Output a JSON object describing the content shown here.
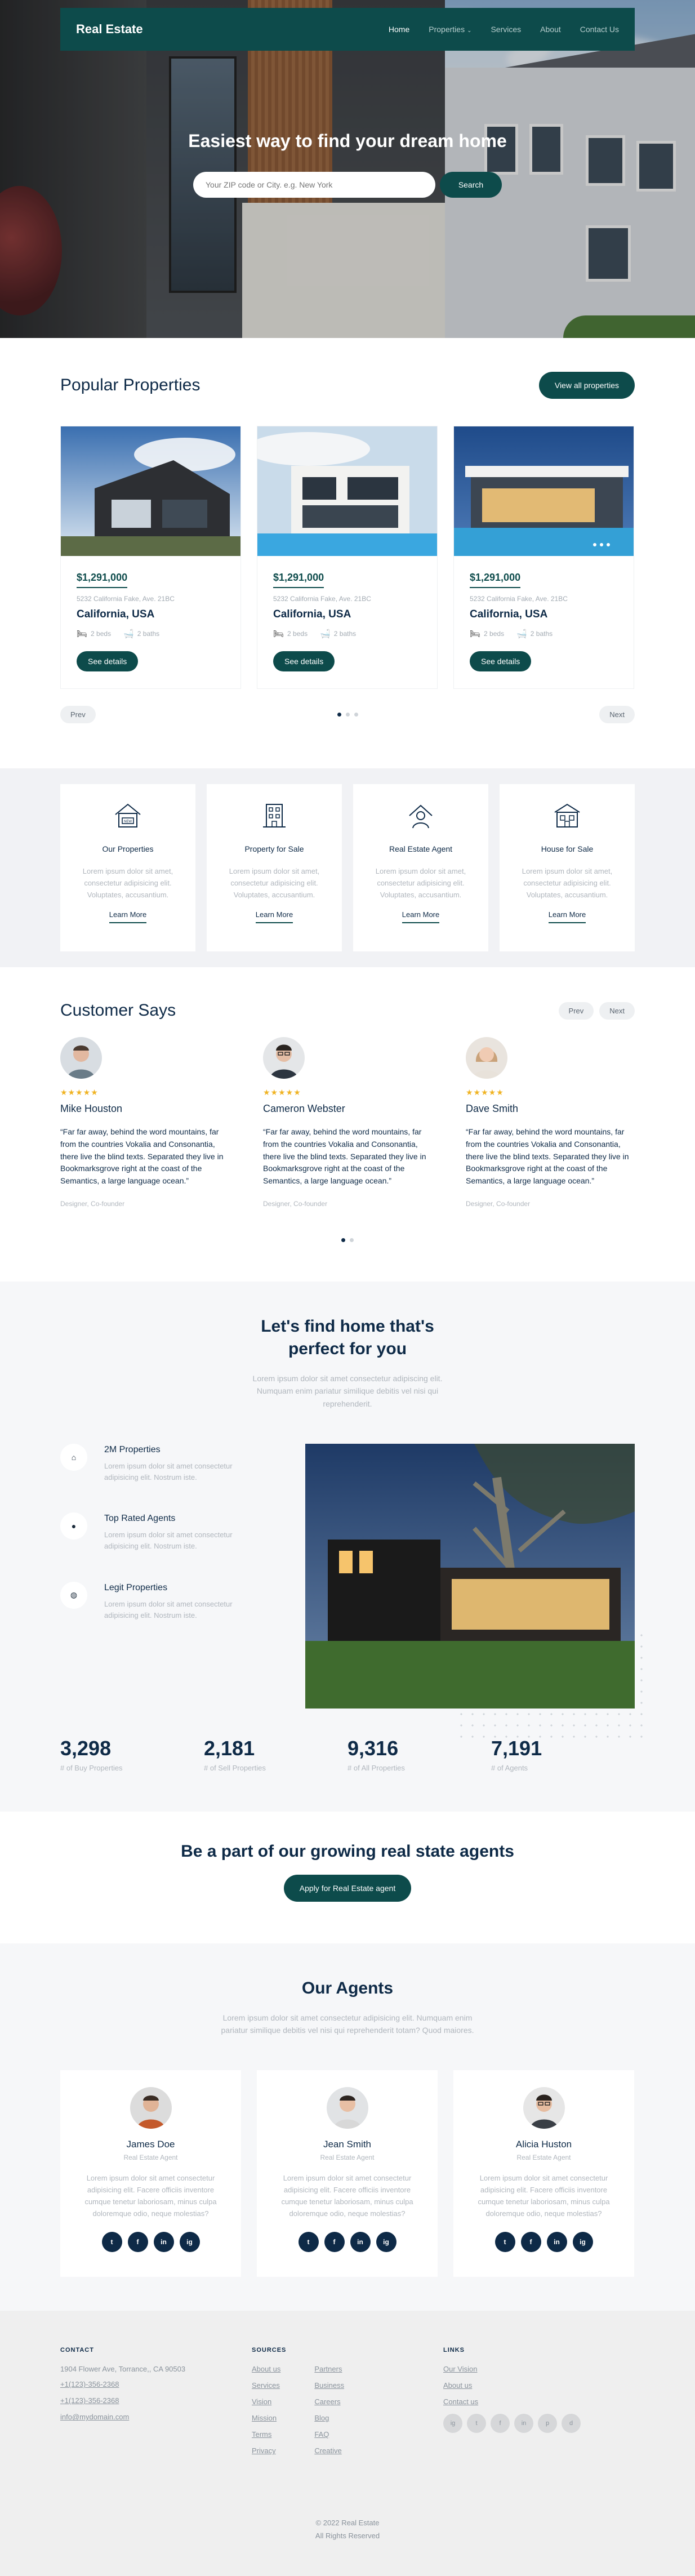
{
  "nav": {
    "brand": "Real Estate",
    "links": [
      "Home",
      "Properties",
      "Services",
      "About",
      "Contact Us"
    ]
  },
  "hero": {
    "title": "Easiest way to find your dream home",
    "search_placeholder": "Your ZIP code or City. e.g. New York",
    "search_button": "Search"
  },
  "popular": {
    "title": "Popular Properties",
    "view_all": "View all properties",
    "cards": [
      {
        "price": "$1,291,000",
        "address": "5232 California Fake, Ave. 21BC",
        "city": "California, USA",
        "beds": "2 beds",
        "baths": "2 baths",
        "button": "See details"
      },
      {
        "price": "$1,291,000",
        "address": "5232 California Fake, Ave. 21BC",
        "city": "California, USA",
        "beds": "2 beds",
        "baths": "2 baths",
        "button": "See details"
      },
      {
        "price": "$1,291,000",
        "address": "5232 California Fake, Ave. 21BC",
        "city": "California, USA",
        "beds": "2 beds",
        "baths": "2 baths",
        "button": "See details"
      }
    ],
    "prev": "Prev",
    "next": "Next"
  },
  "features": [
    {
      "title": "Our Properties",
      "text": "Lorem ipsum dolor sit amet, consectetur adipisicing elit. Voluptates, accusantium.",
      "link": "Learn More",
      "icon": "house-icon"
    },
    {
      "title": "Property for Sale",
      "text": "Lorem ipsum dolor sit amet, consectetur adipisicing elit. Voluptates, accusantium.",
      "link": "Learn More",
      "icon": "building-icon"
    },
    {
      "title": "Real Estate Agent",
      "text": "Lorem ipsum dolor sit amet, consectetur adipisicing elit. Voluptates, accusantium.",
      "link": "Learn More",
      "icon": "agent-icon"
    },
    {
      "title": "House for Sale",
      "text": "Lorem ipsum dolor sit amet, consectetur adipisicing elit. Voluptates, accusantium.",
      "link": "Learn More",
      "icon": "house-sale-icon"
    }
  ],
  "testimonials": {
    "title": "Customer Says",
    "prev": "Prev",
    "next": "Next",
    "stars": "★★★★★",
    "items": [
      {
        "name": "Mike Houston",
        "quote": "“Far far away, behind the word mountains, far from the countries Vokalia and Consonantia, there live the blind texts. Separated they live in Bookmarksgrove right at the coast of the Semantics, a large language ocean.”",
        "role": "Designer, Co-founder"
      },
      {
        "name": "Cameron Webster",
        "quote": "“Far far away, behind the word mountains, far from the countries Vokalia and Consonantia, there live the blind texts. Separated they live in Bookmarksgrove right at the coast of the Semantics, a large language ocean.”",
        "role": "Designer, Co-founder"
      },
      {
        "name": "Dave Smith",
        "quote": "“Far far away, behind the word mountains, far from the countries Vokalia and Consonantia, there live the blind texts. Separated they live in Bookmarksgrove right at the coast of the Semantics, a large language ocean.”",
        "role": "Designer, Co-founder"
      }
    ]
  },
  "why": {
    "title_line1": "Let's find home that's",
    "title_line2": "perfect for you",
    "subtitle": "Lorem ipsum dolor sit amet consectetur adipiscing elit. Numquam enim pariatur similique debitis vel nisi qui reprehenderit.",
    "items": [
      {
        "title": "2M Properties",
        "text": "Lorem ipsum dolor sit amet consectetur adipisicing elit. Nostrum iste.",
        "icon": "home-icon"
      },
      {
        "title": "Top Rated Agents",
        "text": "Lorem ipsum dolor sit amet consectetur adipisicing elit. Nostrum iste.",
        "icon": "person-icon"
      },
      {
        "title": "Legit Properties",
        "text": "Lorem ipsum dolor sit amet consectetur adipisicing elit. Nostrum iste.",
        "icon": "shield-icon"
      }
    ],
    "stats": [
      {
        "num": "3,298",
        "label": "# of Buy Properties"
      },
      {
        "num": "2,181",
        "label": "# of Sell Properties"
      },
      {
        "num": "9,316",
        "label": "# of All Properties"
      },
      {
        "num": "7,191",
        "label": "# of Agents"
      }
    ]
  },
  "cta": {
    "title": "Be a part of our growing real state agents",
    "button": "Apply for Real Estate agent"
  },
  "agents": {
    "title": "Our Agents",
    "subtitle": "Lorem ipsum dolor sit amet consectetur adipisicing elit. Numquam enim pariatur similique debitis vel nisi qui reprehenderit totam? Quod maiores.",
    "items": [
      {
        "name": "James Doe",
        "role": "Real Estate Agent",
        "text": "Lorem ipsum dolor sit amet consectetur adipisicing elit. Facere officiis inventore cumque tenetur laboriosam, minus culpa doloremque odio, neque molestias?"
      },
      {
        "name": "Jean Smith",
        "role": "Real Estate Agent",
        "text": "Lorem ipsum dolor sit amet consectetur adipisicing elit. Facere officiis inventore cumque tenetur laboriosam, minus culpa doloremque odio, neque molestias?"
      },
      {
        "name": "Alicia Huston",
        "role": "Real Estate Agent",
        "text": "Lorem ipsum dolor sit amet consectetur adipisicing elit. Facere officiis inventore cumque tenetur laboriosam, minus culpa doloremque odio, neque molestias?"
      }
    ],
    "socials": [
      "t",
      "f",
      "in",
      "ig"
    ]
  },
  "footer": {
    "contact_head": "CONTACT",
    "address": "1904 Flower Ave, Torrance,, CA 90503",
    "phone1": "+1(123)-356-2368",
    "phone2": "+1(123)-356-2368",
    "email": "info@mydomain.com",
    "sources_head": "SOURCES",
    "sources_a": [
      "About us",
      "Services",
      "Vision",
      "Mission",
      "Terms",
      "Privacy"
    ],
    "sources_b": [
      "Partners",
      "Business",
      "Careers",
      "Blog",
      "FAQ",
      "Creative"
    ],
    "links_head": "LINKS",
    "links": [
      "Our Vision",
      "About us",
      "Contact us"
    ],
    "socials": [
      "ig",
      "t",
      "f",
      "in",
      "p",
      "d"
    ],
    "copy1": "© 2022 Real Estate",
    "copy2": "All Rights Reserved"
  },
  "colors": {
    "primary": "#0d4b4b",
    "navy": "#0e2a47",
    "muted": "#b0b6bd",
    "star": "#f0b322"
  }
}
